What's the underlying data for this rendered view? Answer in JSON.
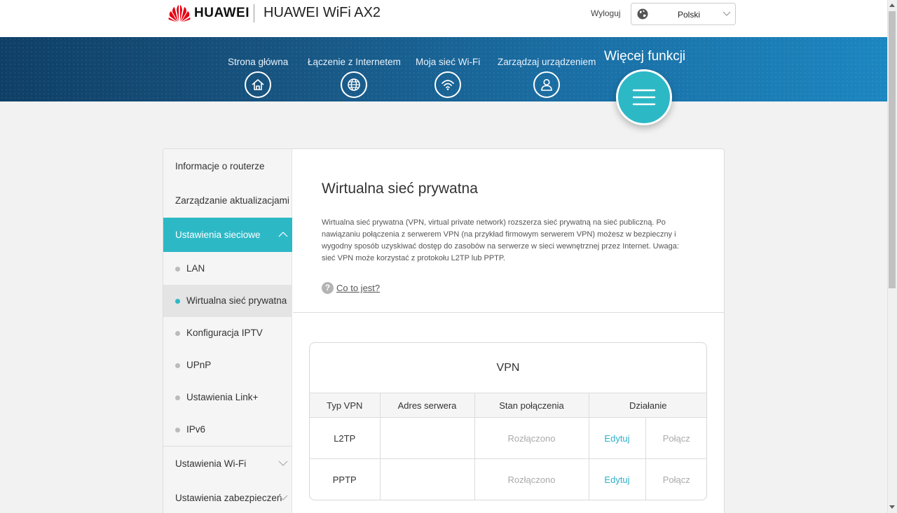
{
  "header": {
    "brand": "HUAWEI",
    "product": "HUAWEI WiFi AX2",
    "logout": "Wyloguj",
    "language": "Polski",
    "brand_color": "#e60012"
  },
  "nav": {
    "items": [
      {
        "label": "Strona główna",
        "icon": "home-icon"
      },
      {
        "label": "Łączenie z Internetem",
        "icon": "globe-icon"
      },
      {
        "label": "Moja sieć Wi-Fi",
        "icon": "wifi-icon"
      },
      {
        "label": "Zarządzaj urządzeniem",
        "icon": "user-icon"
      }
    ],
    "more": {
      "label": "Więcej funkcji",
      "icon": "menu-icon"
    },
    "accent": "#2db8c6"
  },
  "sidebar": {
    "items": [
      {
        "label": "Informacje o routerze"
      },
      {
        "label": "Zarządzanie aktualizacjami"
      },
      {
        "label": "Ustawienia sieciowe",
        "expanded": true
      },
      {
        "label": "Ustawienia Wi-Fi",
        "expanded": false
      },
      {
        "label": "Ustawienia zabezpieczeń",
        "expanded": false
      }
    ],
    "subitems": [
      {
        "label": "LAN"
      },
      {
        "label": "Wirtualna sieć prywatna",
        "selected": true
      },
      {
        "label": "Konfiguracja IPTV"
      },
      {
        "label": "UPnP"
      },
      {
        "label": "Ustawienia Link+"
      },
      {
        "label": "IPv6"
      }
    ]
  },
  "main": {
    "title": "Wirtualna sieć prywatna",
    "description": "Wirtualna sieć prywatna (VPN, virtual private network) rozszerza sieć prywatną na sieć publiczną. Po nawiązaniu połączenia z serwerem VPN (na przykład firmowym serwerem VPN) możesz w bezpieczny i wygodny sposób uzyskiwać dostęp do zasobów na serwerze w sieci wewnętrznej przez Internet. Uwaga: sieć VPN może korzystać z protokołu L2TP lub PPTP.",
    "help_icon": "?",
    "help_link": "Co to jest?",
    "vpn": {
      "title": "VPN",
      "columns": [
        "Typ VPN",
        "Adres serwera",
        "Stan połączenia",
        "Działanie"
      ],
      "rows": [
        {
          "type": "L2TP",
          "server": "",
          "status": "Rozłączono",
          "edit": "Edytuj",
          "connect": "Połącz"
        },
        {
          "type": "PPTP",
          "server": "",
          "status": "Rozłączono",
          "edit": "Edytuj",
          "connect": "Połącz"
        }
      ]
    }
  }
}
